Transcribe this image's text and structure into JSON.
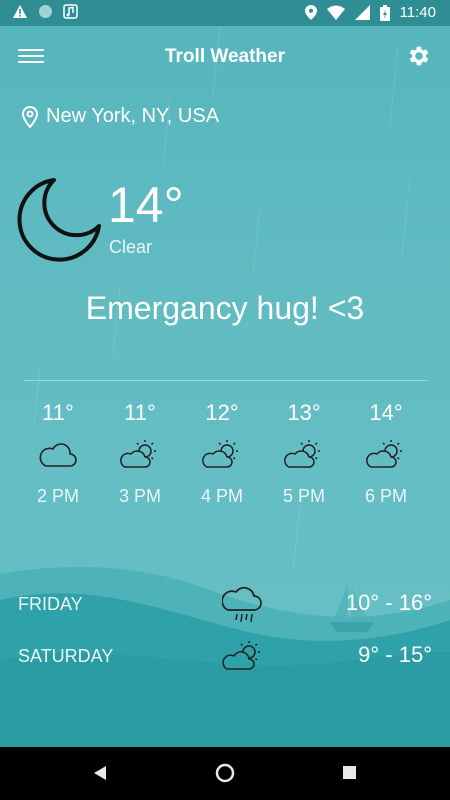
{
  "status_bar": {
    "time": "11:40"
  },
  "toolbar": {
    "title": "Troll Weather"
  },
  "location": {
    "name": "New York, NY, USA"
  },
  "current": {
    "temperature": "14°",
    "condition": "Clear",
    "icon": "moon-icon"
  },
  "message": "Emergancy hug! <3",
  "hourly": [
    {
      "temp": "11°",
      "time": "2 PM",
      "icon": "cloud-icon"
    },
    {
      "temp": "11°",
      "time": "3 PM",
      "icon": "partly-cloudy-icon"
    },
    {
      "temp": "12°",
      "time": "4 PM",
      "icon": "partly-cloudy-icon"
    },
    {
      "temp": "13°",
      "time": "5 PM",
      "icon": "partly-cloudy-icon"
    },
    {
      "temp": "14°",
      "time": "6 PM",
      "icon": "partly-cloudy-icon"
    }
  ],
  "daily": [
    {
      "day": "FRIDAY",
      "range": "10° - 16°",
      "icon": "rain-cloud-icon"
    },
    {
      "day": "SATURDAY",
      "range": "9° - 15°",
      "icon": "partly-cloudy-icon"
    }
  ],
  "colors": {
    "status_bar": "#2f8e93",
    "background": "#5bb7bd",
    "wave": "#2fa1a8"
  }
}
